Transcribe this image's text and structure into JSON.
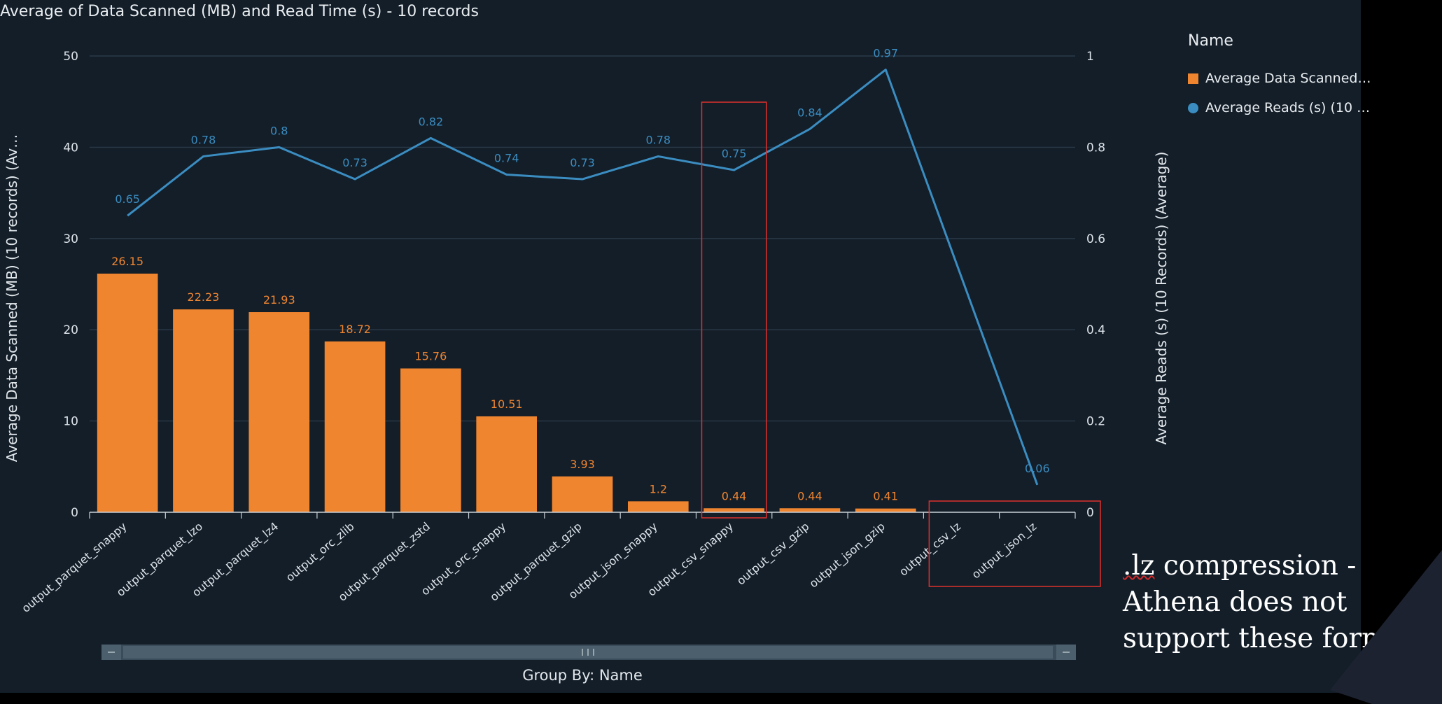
{
  "title": "Average of Data Scanned (MB) and Read Time (s) - 10 records",
  "legend": {
    "title": "Name",
    "items": [
      "Average Data Scanned…",
      "Average Reads (s) (10 …"
    ]
  },
  "annotation": {
    "prefix": ".lz",
    "text": " compression - Athena does not support these formats"
  },
  "colors": {
    "bar": "#f08530",
    "line": "#3b8dc1",
    "highlight_box": "#e0302e"
  },
  "chart_data": {
    "type": "bar",
    "categories": [
      "output_parquet_snappy",
      "output_parquet_lzo",
      "output_parquet_lz4",
      "output_orc_zlib",
      "output_parquet_zstd",
      "output_orc_snappy",
      "output_parquet_gzip",
      "output_json_snappy",
      "output_csv_snappy",
      "output_csv_gzip",
      "output_json_gzip",
      "output_csv_lz",
      "output_json_lz"
    ],
    "series": [
      {
        "type": "bar",
        "axis": "left",
        "values": [
          26.15,
          22.23,
          21.93,
          18.72,
          15.76,
          10.51,
          3.93,
          1.2,
          0.44,
          0.44,
          0.41,
          null,
          null
        ]
      },
      {
        "type": "line",
        "axis": "right",
        "values": [
          0.65,
          0.78,
          0.8,
          0.73,
          0.82,
          0.74,
          0.73,
          0.78,
          0.75,
          0.84,
          0.97,
          null,
          0.06
        ]
      }
    ],
    "bar_labels": [
      "26.15",
      "22.23",
      "21.93",
      "18.72",
      "15.76",
      "10.51",
      "3.93",
      "1.2",
      "0.44",
      "0.44",
      "0.41",
      "",
      ""
    ],
    "line_labels": [
      "0.65",
      "0.78",
      "0.8",
      "0.73",
      "0.82",
      "0.74",
      "0.73",
      "0.78",
      "0.75",
      "0.84",
      "0.97",
      "",
      "0.06"
    ],
    "ylabel": "Average Data Scanned (MB) (10 records) (Av…",
    "y2label": "Average Reads (s) (10 Records) (Average)",
    "xlabel": "Group By: Name",
    "ylim": [
      0,
      50
    ],
    "y2lim": [
      0,
      1
    ],
    "yticks": [
      "0",
      "10",
      "20",
      "30",
      "40",
      "50"
    ],
    "y2ticks": [
      "0",
      "0.2",
      "0.4",
      "0.6",
      "0.8",
      "1"
    ],
    "grid": true,
    "highlights": [
      {
        "from_category": "output_csv_snappy",
        "to_category": "output_csv_snappy"
      },
      {
        "from_category": "output_csv_lz",
        "to_category": "output_json_lz"
      }
    ]
  }
}
